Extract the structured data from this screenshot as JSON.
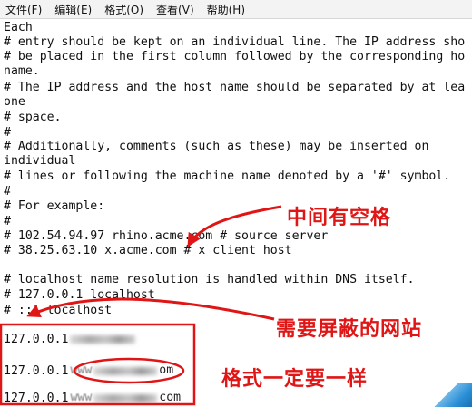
{
  "menu": [
    "文件(F)",
    "编辑(E)",
    "格式(O)",
    "查看(V)",
    "帮助(H)"
  ],
  "lines": [
    "Each",
    "# entry should be kept on an individual line. The IP address sho",
    "# be placed in the first column followed by the corresponding ho",
    "name.",
    "# The IP address and the host name should be separated by at lea",
    "one",
    "# space.",
    "#",
    "# Additionally, comments (such as these) may be inserted on",
    "individual",
    "# lines or following the machine name denoted by a '#' symbol.",
    "#",
    "# For example:",
    "#",
    "# 102.54.94.97 rhino.acme.com # source server",
    "# 38.25.63.10 x.acme.com # x client host",
    "",
    "# localhost name resolution is handled within DNS itself.",
    "# 127.0.0.1 localhost",
    "# ::1 localhost",
    "",
    "127.0.0.1",
    "",
    "127.0.0.1",
    "",
    "127.0.0.1"
  ],
  "blocked_entries": [
    {
      "ip": "127.0.0.1",
      "prefix": "",
      "suffix": ""
    },
    {
      "ip": "127.0.0.1",
      "prefix": "www",
      "suffix": "om"
    },
    {
      "ip": "127.0.0.1",
      "prefix": "www",
      "suffix": "com"
    }
  ],
  "annotations": {
    "space_note": "中间有空格",
    "blocked_sites_note": "需要屏蔽的网站",
    "format_note": "格式一定要一样"
  },
  "colors": {
    "annotation": "#e01515",
    "menubar": "#f3f3f3"
  }
}
